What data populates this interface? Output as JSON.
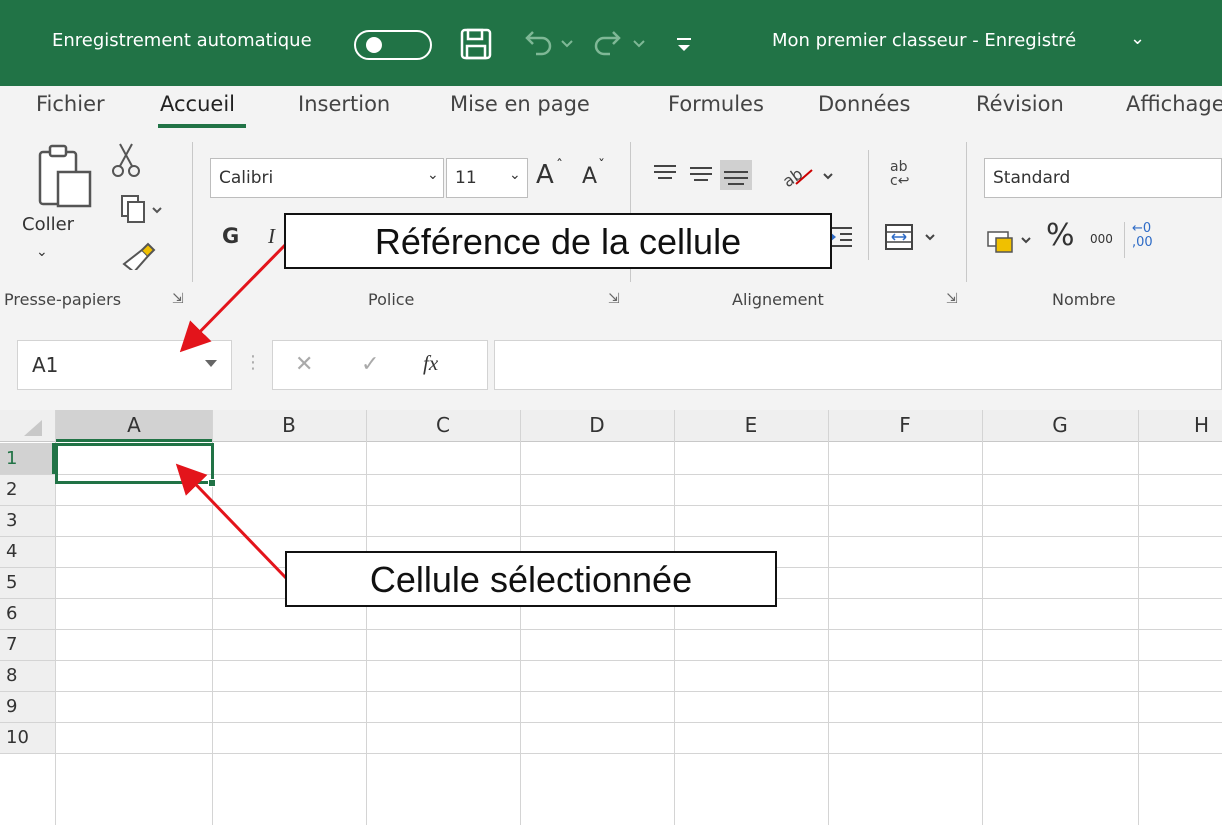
{
  "titlebar": {
    "autosave_label": "Enregistrement automatique",
    "document_title": "Mon premier classeur  -  Enregistré",
    "title_chevron": "⌄",
    "save_icon": "floppy-icon",
    "undo_icon": "undo-icon",
    "redo_icon": "redo-icon",
    "qat_icon": "customize-qat-icon",
    "bg_color": "#217346"
  },
  "tabs": [
    "Fichier",
    "Accueil",
    "Insertion",
    "Mise en page",
    "Formules",
    "Données",
    "Révision",
    "Affichage"
  ],
  "active_tab": "Accueil",
  "ribbon": {
    "clipboard": {
      "paste_label": "Coller",
      "group_label": "Presse-papiers"
    },
    "font": {
      "font_name": "Calibri",
      "font_size": "11",
      "grow": "A",
      "shrink": "A",
      "bold": "G",
      "italic": "I",
      "group_label": "Police"
    },
    "alignment": {
      "group_label": "Alignement"
    },
    "number": {
      "format": "Standard",
      "percent": "%",
      "thousands": "000",
      "group_label": "Nombre"
    }
  },
  "formula_bar": {
    "name_box": "A1",
    "cancel": "✕",
    "enter": "✓",
    "fx": "fx",
    "formula_value": ""
  },
  "grid": {
    "columns": [
      "A",
      "B",
      "C",
      "D",
      "E",
      "F",
      "G",
      "H"
    ],
    "rows": [
      "1",
      "2",
      "3",
      "4",
      "5",
      "6",
      "7",
      "8",
      "9",
      "10"
    ],
    "selected_cell": "A1",
    "selection_color": "#217346"
  },
  "annotations": {
    "cell_reference": "Référence de la cellule",
    "selected_cell": "Cellule sélectionnée",
    "arrow_color": "#e3141b"
  }
}
